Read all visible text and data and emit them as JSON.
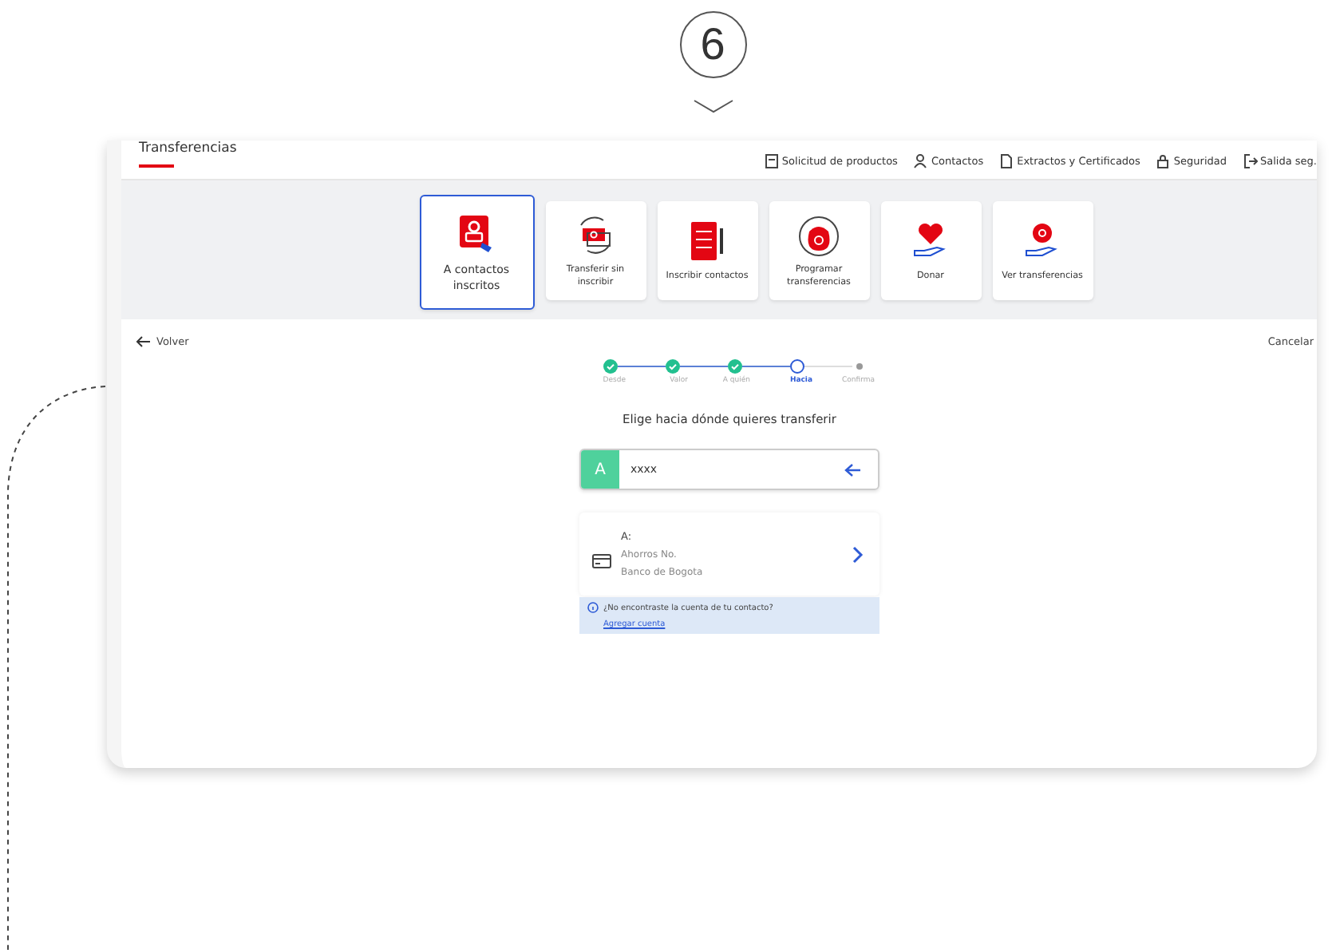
{
  "step_badge": {
    "number": "6"
  },
  "header": {
    "title": "Transferencias",
    "nav": [
      {
        "label": "Solicitud de productos"
      },
      {
        "label": "Contactos"
      },
      {
        "label": "Extractos y Certificados"
      },
      {
        "label": "Seguridad"
      },
      {
        "label": "Salida seg."
      }
    ]
  },
  "tiles": [
    {
      "label": "A contactos inscritos",
      "selected": true
    },
    {
      "label": "Transferir sin inscribir",
      "selected": false
    },
    {
      "label": "Inscribir contactos",
      "selected": false
    },
    {
      "label": "Programar transferencias",
      "selected": false
    },
    {
      "label": "Donar",
      "selected": false
    },
    {
      "label": "Ver transferencias",
      "selected": false
    }
  ],
  "back_link": "Volver",
  "cancel_link": "Cancelar",
  "stepper": [
    {
      "label": "Desde",
      "completed": true,
      "selected": false
    },
    {
      "label": "Valor",
      "completed": true,
      "selected": false
    },
    {
      "label": "A quién",
      "completed": true,
      "selected": false
    },
    {
      "label": "Hacia",
      "completed": false,
      "selected": true
    },
    {
      "label": "Confirma",
      "completed": false,
      "selected": false
    }
  ],
  "prompt": "Elige hacia dónde quieres transferir",
  "contact": {
    "initial": "A",
    "name": "xxxx"
  },
  "account": {
    "title": "A:",
    "type": "Ahorros No.",
    "bank": "Banco de Bogota"
  },
  "notice": {
    "text": "¿No encontraste la cuenta de tu contacto?",
    "link": "Agregar cuenta"
  }
}
